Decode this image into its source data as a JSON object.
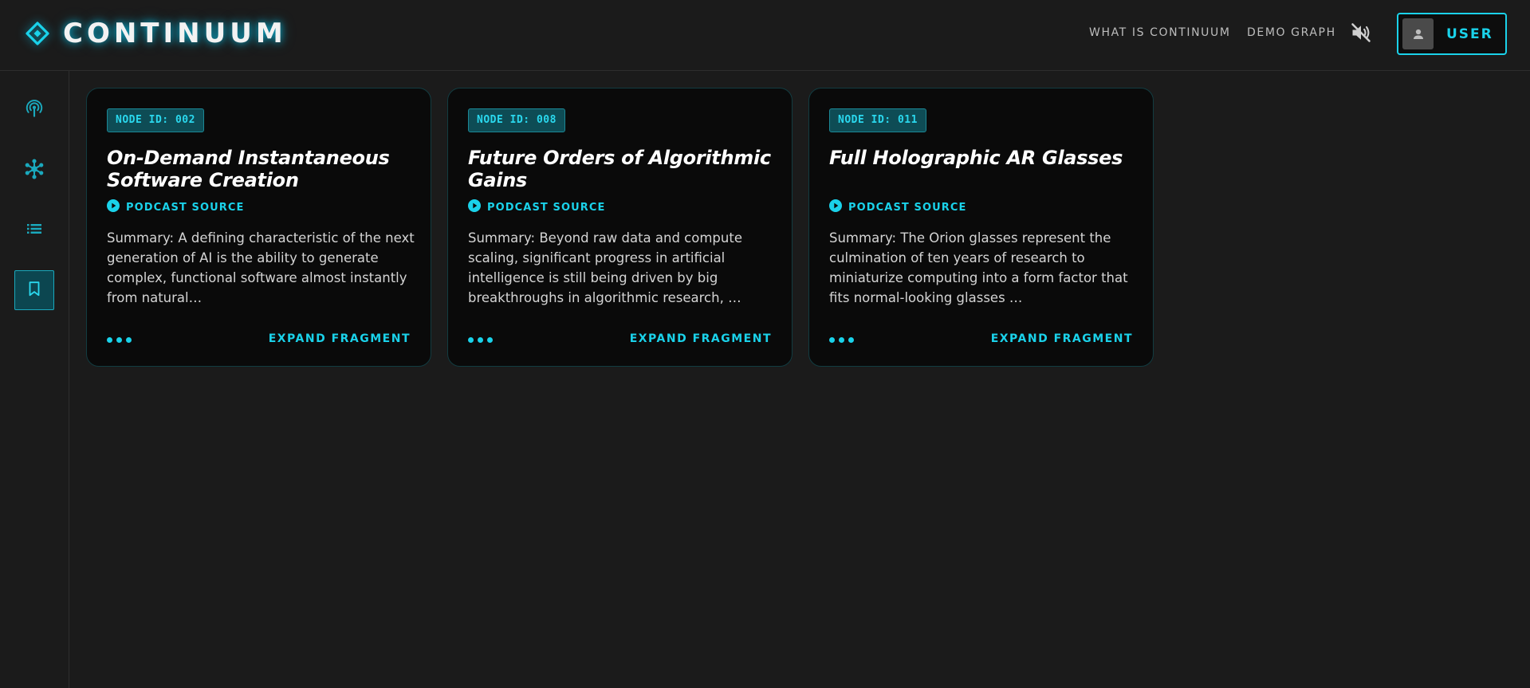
{
  "app": {
    "title": "CONTINUUM"
  },
  "header": {
    "nav_about": "WHAT IS CONTINUUM",
    "nav_demo": "DEMO GRAPH",
    "mute_icon": "volume-off-icon",
    "user_label": "USER"
  },
  "colors": {
    "accent": "#1ad2ea",
    "background": "#1b1b1b",
    "card_background": "#0a0a0a"
  },
  "sidebar": {
    "items": [
      {
        "icon": "podcast-icon"
      },
      {
        "icon": "graph-nodes-icon"
      },
      {
        "icon": "list-icon"
      },
      {
        "icon": "bookmark-icon",
        "active": true
      }
    ]
  },
  "cards": [
    {
      "node_id": "NODE ID: 002",
      "title": "On-Demand Instantaneous Software Creation",
      "source_label": "PODCAST SOURCE",
      "summary": "Summary: A defining characteristic of the next generation of AI is the ability to generate complex, functional software almost instantly from natural…",
      "expand_label": "EXPAND FRAGMENT"
    },
    {
      "node_id": "NODE ID: 008",
      "title": "Future Orders of Algorithmic Gains",
      "source_label": "PODCAST SOURCE",
      "summary": "Summary: Beyond raw data and compute scaling, significant progress in artificial intelligence is still being driven by big breakthroughs in algorithmic research, …",
      "expand_label": "EXPAND FRAGMENT"
    },
    {
      "node_id": "NODE ID: 011",
      "title": "Full Holographic AR Glasses",
      "source_label": "PODCAST SOURCE",
      "summary": "Summary: The Orion glasses represent the culmination of ten years of research to miniaturize computing into a form factor that fits normal-looking glasses …",
      "expand_label": "EXPAND FRAGMENT"
    }
  ]
}
